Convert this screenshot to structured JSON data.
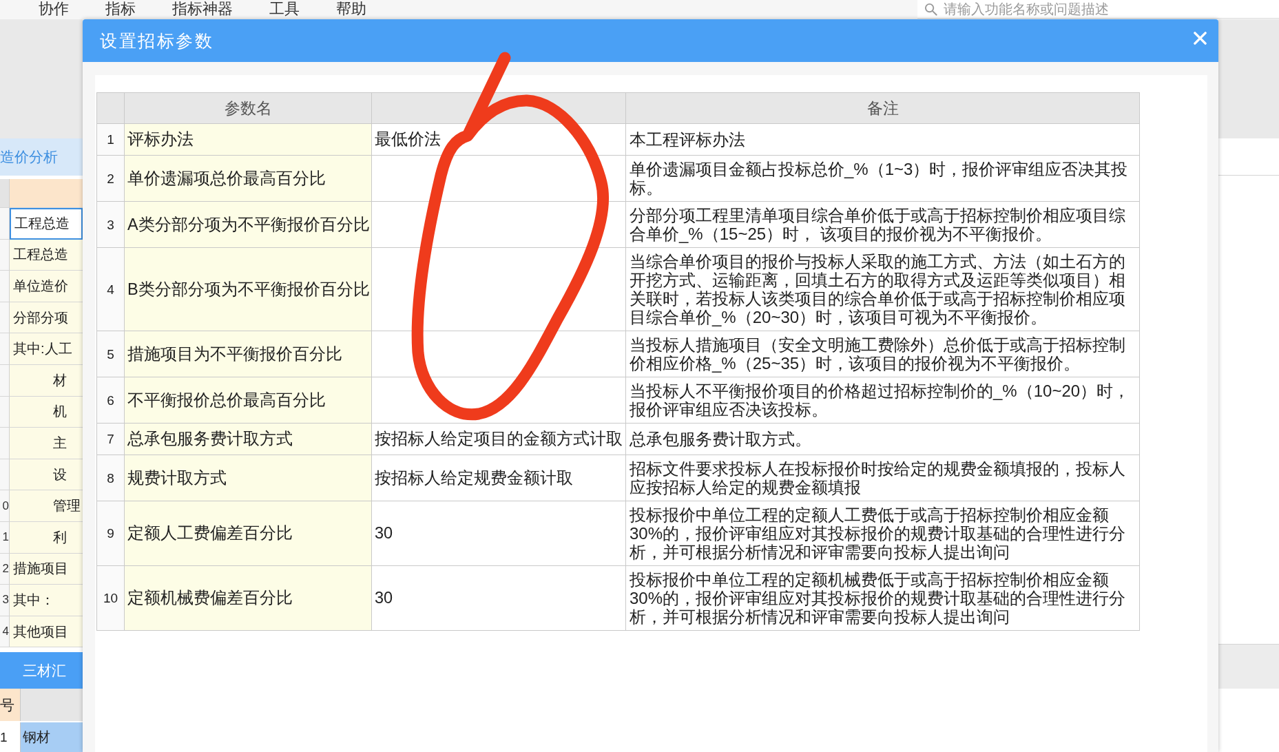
{
  "menu_bar": {
    "items": [
      {
        "label": "协作"
      },
      {
        "label": "指标"
      },
      {
        "label": "指标神器"
      },
      {
        "label": "工具"
      },
      {
        "label": "帮助"
      }
    ],
    "search": {
      "placeholder": "请输入功能名称或问题描述"
    }
  },
  "cost_panel": {
    "title": "造价分析",
    "rows": [
      {
        "label": "工程总造",
        "selected": true
      },
      {
        "label": "工程总造",
        "selected": false
      },
      {
        "label": "单位造价",
        "selected": false
      },
      {
        "label": "分部分项",
        "selected": false
      },
      {
        "label": "其中:人工",
        "selected": false,
        "children": [
          {
            "label": "材",
            "selected": false
          },
          {
            "label": "机",
            "selected": false
          },
          {
            "label": "主",
            "selected": false
          },
          {
            "label": "设",
            "selected": false
          },
          {
            "number": "0",
            "label": "管理",
            "selected": false
          },
          {
            "number": "1",
            "label": "利",
            "selected": false
          }
        ]
      },
      {
        "number": "2",
        "label": "措施项目",
        "selected": false
      },
      {
        "number": "3",
        "label": "其中：",
        "selected": false
      },
      {
        "number": "4",
        "label": "其他项目",
        "selected": false
      }
    ]
  },
  "materials_panel": {
    "title": "三材汇",
    "columns": [
      "号"
    ],
    "rows": [
      {
        "number": "1",
        "label": "钢材",
        "selected": true
      }
    ]
  },
  "dialog": {
    "title": "设置招标参数",
    "table": {
      "columns": [
        {
          "kind": "text",
          "label": "参数名"
        },
        {
          "kind": "covered"
        },
        {
          "kind": "text",
          "label": "备注"
        }
      ],
      "rows": [
        {
          "number": "1",
          "name": "评标办法",
          "value": "最低价法",
          "note": "本工程评标办法"
        },
        {
          "number": "2",
          "name": "单价遗漏项总价最高百分比",
          "note": "单价遗漏项目金额占投标总价_%（1~3）时，报价评审组应否决其投标。"
        },
        {
          "number": "3",
          "name": "A类分部分项为不平衡报价百分比",
          "note": "分部分项工程里清单项目综合单价低于或高于招标控制价相应项目综合单价_%（15~25）时， 该项目的报价视为不平衡报价。"
        },
        {
          "number": "4",
          "name": "B类分部分项为不平衡报价百分比",
          "note": "当综合单价项目的报价与投标人采取的施工方式、方法（如土石方的开挖方式、运输距离，回填土石方的取得方式及运距等类似项目）相关联时，若投标人该类项目的综合单价低于或高于招标控制价相应项目综合单价_%（20~30）时，该项目可视为不平衡报价。"
        },
        {
          "number": "5",
          "name": "措施项目为不平衡报价百分比",
          "note": "当投标人措施项目（安全文明施工费除外）总价低于或高于招标控制价相应价格_%（25~35）时，该项目的报价视为不平衡报价。"
        },
        {
          "number": "6",
          "name": "不平衡报价总价最高百分比",
          "note": "当投标人不平衡报价项目的价格超过招标控制价的_%（10~20）时，报价评审组应否决该投标。"
        },
        {
          "number": "7",
          "name": "总承包服务费计取方式",
          "value": "按招标人给定项目的金额方式计取",
          "note": "总承包服务费计取方式。"
        },
        {
          "number": "8",
          "name": "规费计取方式",
          "value": "按招标人给定规费金额计取",
          "note": "招标文件要求投标人在投标报价时按给定的规费金额填报的，投标人应按招标人给定的规费金额填报"
        },
        {
          "number": "9",
          "name": "定额人工费偏差百分比",
          "value": "30",
          "note": "投标报价中单位工程的定额人工费低于或高于招标控制价相应金额30%的，报价评审组应对其投标报价的规费计取基础的合理性进行分析，并可根据分析情况和评审需要向投标人提出询问"
        },
        {
          "number": "10",
          "name": "定额机械费偏差百分比",
          "value": "30",
          "note": "投标报价中单位工程的定额机械费低于或高于招标控制价相应金额30%的，报价评审组应对其投标报价的规费计取基础的合理性进行分析，并可根据分析情况和评审需要向投标人提出询问"
        }
      ]
    }
  },
  "annotations": [
    {
      "kind": "freehand-loop"
    }
  ]
}
